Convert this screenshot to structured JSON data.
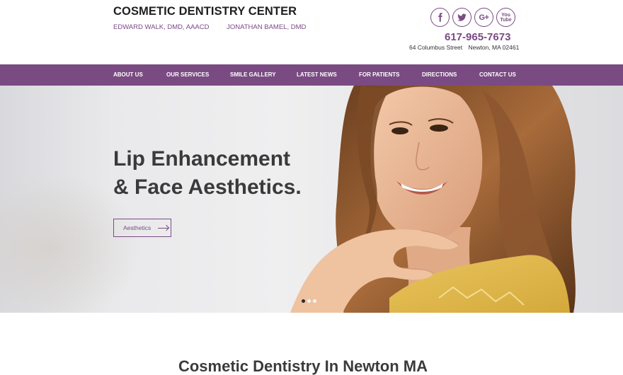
{
  "header": {
    "brand_title": "COSMETIC DENTISTRY CENTER",
    "doctors": [
      "EDWARD WALK, DMD, AAACD",
      "JONATHAN BAMEL, DMD"
    ],
    "phone": "617-965-7673",
    "address_street": "64 Columbus Street",
    "address_city": "Newton, MA 02461",
    "social": {
      "googleplus_label": "G+",
      "youtube_top": "You",
      "youtube_bottom": "Tube"
    }
  },
  "nav": {
    "items": [
      {
        "label": "ABOUT US"
      },
      {
        "label": "OUR SERVICES"
      },
      {
        "label": "SMILE GALLERY"
      },
      {
        "label": "LATEST NEWS"
      },
      {
        "label": "FOR PATIENTS"
      },
      {
        "label": "DIRECTIONS"
      },
      {
        "label": "CONTACT US"
      }
    ]
  },
  "hero": {
    "title_line1": "Lip Enhancement",
    "title_line2": "& Face Aesthetics.",
    "button_label": "Aesthetics"
  },
  "section": {
    "title": "Cosmetic Dentistry In Newton MA"
  },
  "colors": {
    "brand_purple": "#7b4a85",
    "nav_background": "#7a4b82"
  },
  "icons": [
    "facebook-icon",
    "twitter-icon",
    "google-plus-icon",
    "youtube-icon",
    "arrow-right-icon"
  ]
}
